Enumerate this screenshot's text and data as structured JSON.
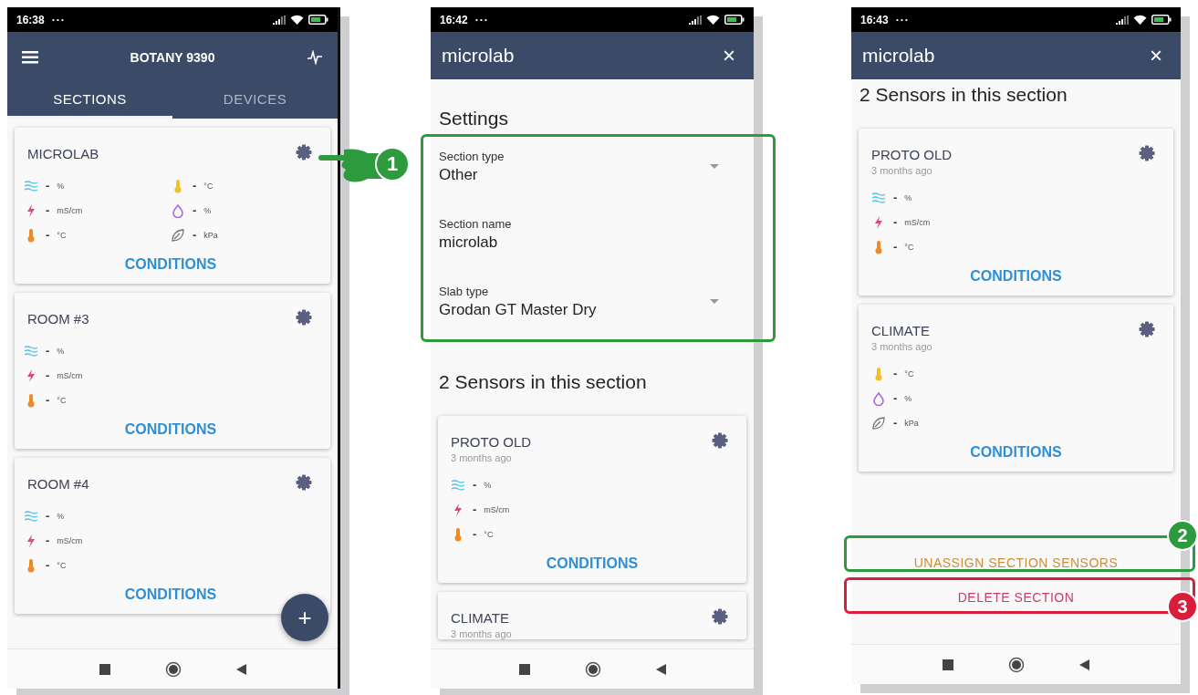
{
  "phones": [
    {
      "status": {
        "time": "16:38",
        "dots": "···"
      },
      "appbar": {
        "kind": "main",
        "title": "BOTANY 9390"
      },
      "tabs": [
        {
          "label": "SECTIONS",
          "selected": true
        },
        {
          "label": "DEVICES",
          "selected": false
        }
      ],
      "blocks": [
        {
          "kind": "card",
          "name": "MICROLAB",
          "columns": [
            {
              "readings": [
                {
                  "kind": "moisture",
                  "value": "-",
                  "unit": "%"
                },
                {
                  "kind": "ec",
                  "value": "-",
                  "unit": "mS/cm"
                },
                {
                  "kind": "temperature",
                  "value": "-",
                  "unit": "°C"
                }
              ]
            },
            {
              "readings": [
                {
                  "kind": "air-temperature",
                  "value": "-",
                  "unit": "°C"
                },
                {
                  "kind": "humidity",
                  "value": "-",
                  "unit": "%"
                },
                {
                  "kind": "vpd",
                  "value": "-",
                  "unit": "kPa"
                }
              ]
            }
          ],
          "link": "CONDITIONS"
        },
        {
          "kind": "card",
          "name": "ROOM #3",
          "columns": [
            {
              "readings": [
                {
                  "kind": "moisture",
                  "value": "-",
                  "unit": "%"
                },
                {
                  "kind": "ec",
                  "value": "-",
                  "unit": "mS/cm"
                },
                {
                  "kind": "temperature",
                  "value": "-",
                  "unit": "°C"
                }
              ]
            }
          ],
          "link": "CONDITIONS"
        },
        {
          "kind": "card",
          "name": "ROOM #4",
          "columns": [
            {
              "readings": [
                {
                  "kind": "moisture",
                  "value": "-",
                  "unit": "%"
                },
                {
                  "kind": "ec",
                  "value": "-",
                  "unit": "mS/cm"
                },
                {
                  "kind": "temperature",
                  "value": "-",
                  "unit": "°C"
                }
              ]
            }
          ],
          "link": "CONDITIONS"
        }
      ],
      "fab": "+"
    },
    {
      "status": {
        "time": "16:42",
        "dots": "···"
      },
      "appbar": {
        "kind": "dialog",
        "title": "microlab",
        "close": "×"
      },
      "blocks": [
        {
          "kind": "heading",
          "text": "Settings"
        },
        {
          "kind": "fields",
          "fields": [
            {
              "kind": "select",
              "label": "Section type",
              "value": "Other"
            },
            {
              "kind": "text",
              "label": "Section name",
              "value": "microlab"
            },
            {
              "kind": "select",
              "label": "Slab type",
              "value": "Grodan GT Master Dry"
            }
          ]
        },
        {
          "kind": "heading",
          "text": "2 Sensors in this section"
        },
        {
          "kind": "card",
          "name": "PROTO OLD",
          "age": "3 months ago",
          "columns": [
            {
              "readings": [
                {
                  "kind": "moisture",
                  "value": "-",
                  "unit": "%"
                },
                {
                  "kind": "ec",
                  "value": "-",
                  "unit": "mS/cm"
                },
                {
                  "kind": "temperature",
                  "value": "-",
                  "unit": "°C"
                }
              ]
            }
          ],
          "link": "CONDITIONS"
        },
        {
          "kind": "card",
          "name": "CLIMATE",
          "age": "3 months ago"
        }
      ]
    },
    {
      "status": {
        "time": "16:43",
        "dots": "···"
      },
      "appbar": {
        "kind": "dialog",
        "title": "microlab",
        "close": "×"
      },
      "blocks": [
        {
          "kind": "heading",
          "text": "2 Sensors in this section"
        },
        {
          "kind": "card",
          "name": "PROTO OLD",
          "age": "3 months ago",
          "columns": [
            {
              "readings": [
                {
                  "kind": "moisture",
                  "value": "-",
                  "unit": "%"
                },
                {
                  "kind": "ec",
                  "value": "-",
                  "unit": "mS/cm"
                },
                {
                  "kind": "temperature",
                  "value": "-",
                  "unit": "°C"
                }
              ]
            }
          ],
          "link": "CONDITIONS"
        },
        {
          "kind": "card",
          "name": "CLIMATE",
          "age": "3 months ago",
          "columns": [
            {
              "readings": [
                {
                  "kind": "air-temperature",
                  "value": "-",
                  "unit": "°C"
                },
                {
                  "kind": "humidity",
                  "value": "-",
                  "unit": "%"
                },
                {
                  "kind": "vpd",
                  "value": "-",
                  "unit": "kPa"
                }
              ]
            }
          ],
          "link": "CONDITIONS"
        },
        {
          "kind": "action",
          "text": "UNASSIGN SECTION SENSORS",
          "color": "#c98f3c"
        },
        {
          "kind": "action",
          "text": "DELETE SECTION",
          "color": "#c73e63"
        }
      ]
    }
  ],
  "annotations": [
    {
      "kind": "pointer",
      "number": "1",
      "color": "#2e9a3e"
    },
    {
      "kind": "frame",
      "color": "#2e9a3e"
    },
    {
      "kind": "frame",
      "number": "2",
      "color": "#2e9a3e"
    },
    {
      "kind": "frame",
      "number": "3",
      "color": "#d81e3a"
    }
  ]
}
